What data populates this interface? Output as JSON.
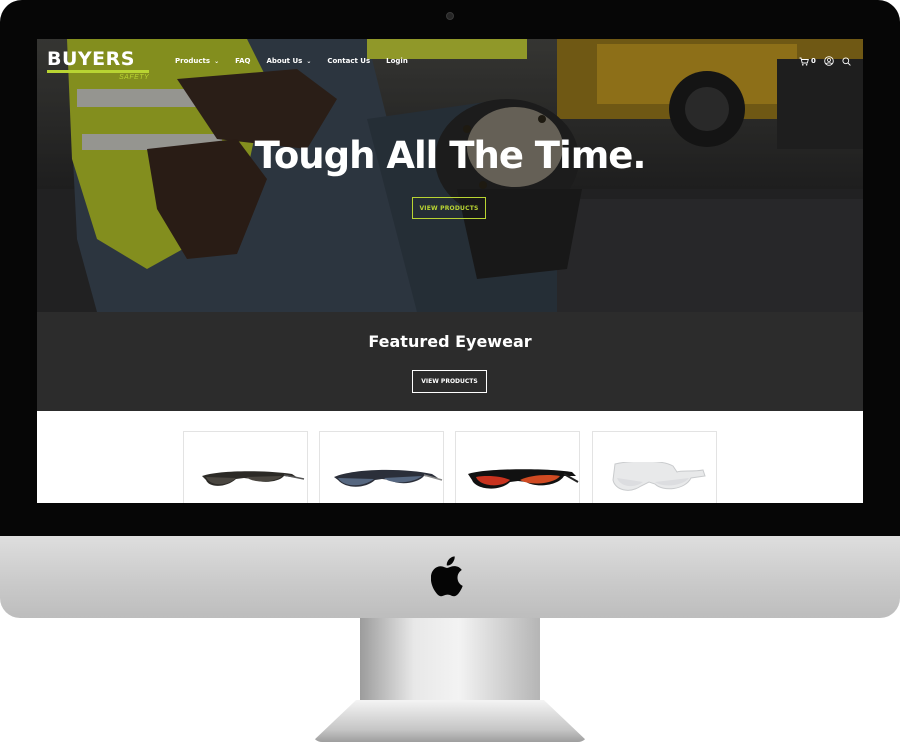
{
  "brand": {
    "name": "BUYERS",
    "tagline": "SAFETY",
    "accent_color": "#b9d432"
  },
  "nav": {
    "items": [
      {
        "label": "Products",
        "has_dropdown": true
      },
      {
        "label": "FAQ",
        "has_dropdown": false
      },
      {
        "label": "About Us",
        "has_dropdown": true
      },
      {
        "label": "Contact Us",
        "has_dropdown": false
      },
      {
        "label": "Login",
        "has_dropdown": false
      }
    ],
    "cart_count": "0",
    "icons": [
      "cart-icon",
      "account-icon",
      "search-icon"
    ]
  },
  "hero": {
    "title": "Tough All The Time.",
    "button_label": "VIEW PRODUCTS"
  },
  "featured": {
    "title": "Featured Eyewear",
    "button_label": "VIEW PRODUCTS",
    "background": "#2c2c2c"
  },
  "products": [
    {
      "name": "smoke-lens-safety-glasses"
    },
    {
      "name": "blue-mirror-safety-glasses"
    },
    {
      "name": "red-mirror-sport-safety-glasses"
    },
    {
      "name": "clear-safety-glasses"
    }
  ]
}
